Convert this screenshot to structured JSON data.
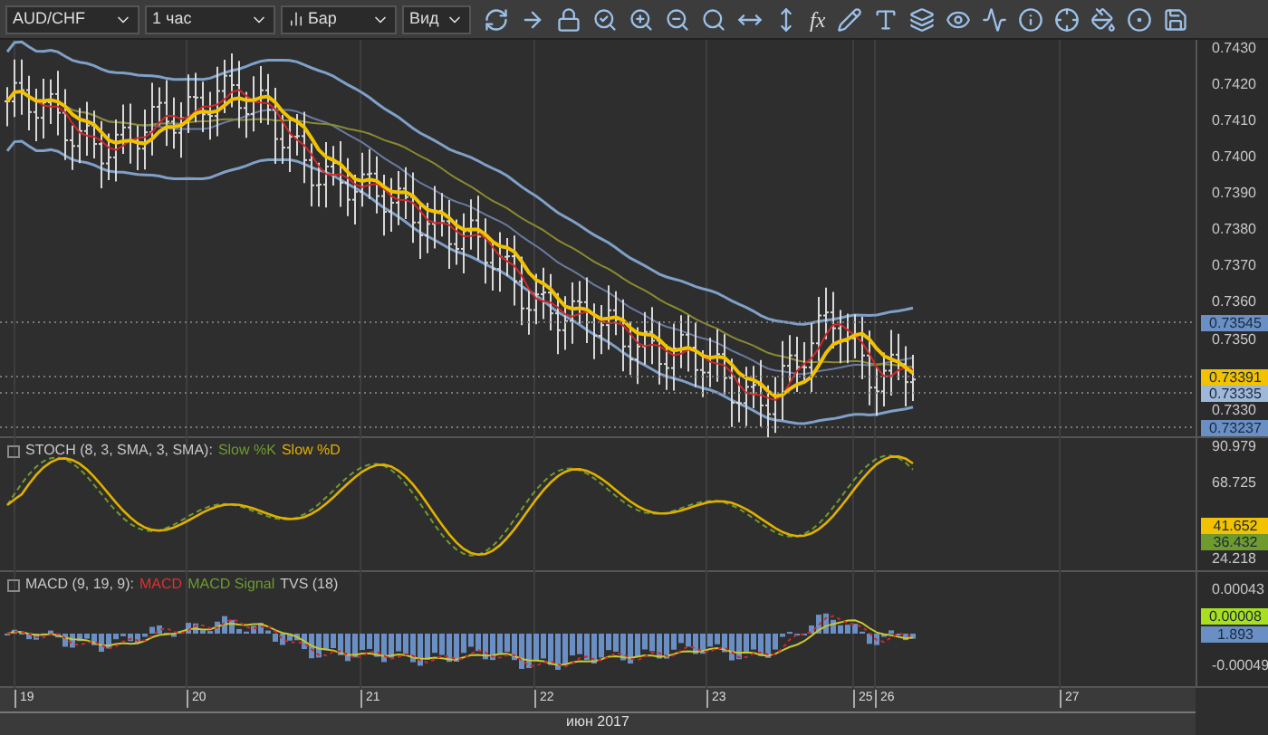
{
  "toolbar": {
    "symbol": "AUD/CHF",
    "timeframe": "1 час",
    "chart_type": "Бар",
    "view": "Вид",
    "formula_glyph": "fx"
  },
  "price_panel": {
    "axis_labels": [
      "0.7430",
      "0.7420",
      "0.7410",
      "0.7400",
      "0.7390",
      "0.7380",
      "0.7370",
      "0.7360",
      "0.7350",
      "0.7330"
    ],
    "badges": [
      {
        "value": "0.73545",
        "color": "#6a8fc4"
      },
      {
        "value": "0.73391",
        "color": "#f2c200"
      },
      {
        "value": "0.73335",
        "color": "#9fb8d8"
      },
      {
        "value": "0.73237",
        "color": "#6a8fc4"
      }
    ]
  },
  "stoch_panel": {
    "legend": [
      {
        "text": "STOCH (8, 3, SMA, 3, SMA):",
        "color": "#c8c8c8"
      },
      {
        "text": "Slow %K",
        "color": "#6f9a2e"
      },
      {
        "text": "Slow %D",
        "color": "#e0b000"
      }
    ],
    "axis_labels": [
      "90.979",
      "68.725",
      "24.218"
    ],
    "badges": [
      {
        "value": "41.652",
        "color": "#f2c200"
      },
      {
        "value": "36.432",
        "color": "#6f9a2e"
      }
    ]
  },
  "macd_panel": {
    "legend": [
      {
        "text": "MACD (9, 19, 9):",
        "color": "#c8c8c8"
      },
      {
        "text": "MACD",
        "color": "#e03030"
      },
      {
        "text": "MACD Signal",
        "color": "#6f9a2e"
      },
      {
        "text": "TVS (18)",
        "color": "#c8c8c8"
      }
    ],
    "axis_labels": [
      "0.00043",
      "-0.00049"
    ],
    "badges": [
      {
        "value": "0.00008",
        "color": "#a8e020"
      },
      {
        "value": "1.893",
        "color": "#6a8fc4"
      }
    ]
  },
  "time_axis": {
    "days": [
      "19",
      "20",
      "21",
      "22",
      "23",
      "25",
      "26",
      "27"
    ],
    "month": "июн 2017"
  }
}
